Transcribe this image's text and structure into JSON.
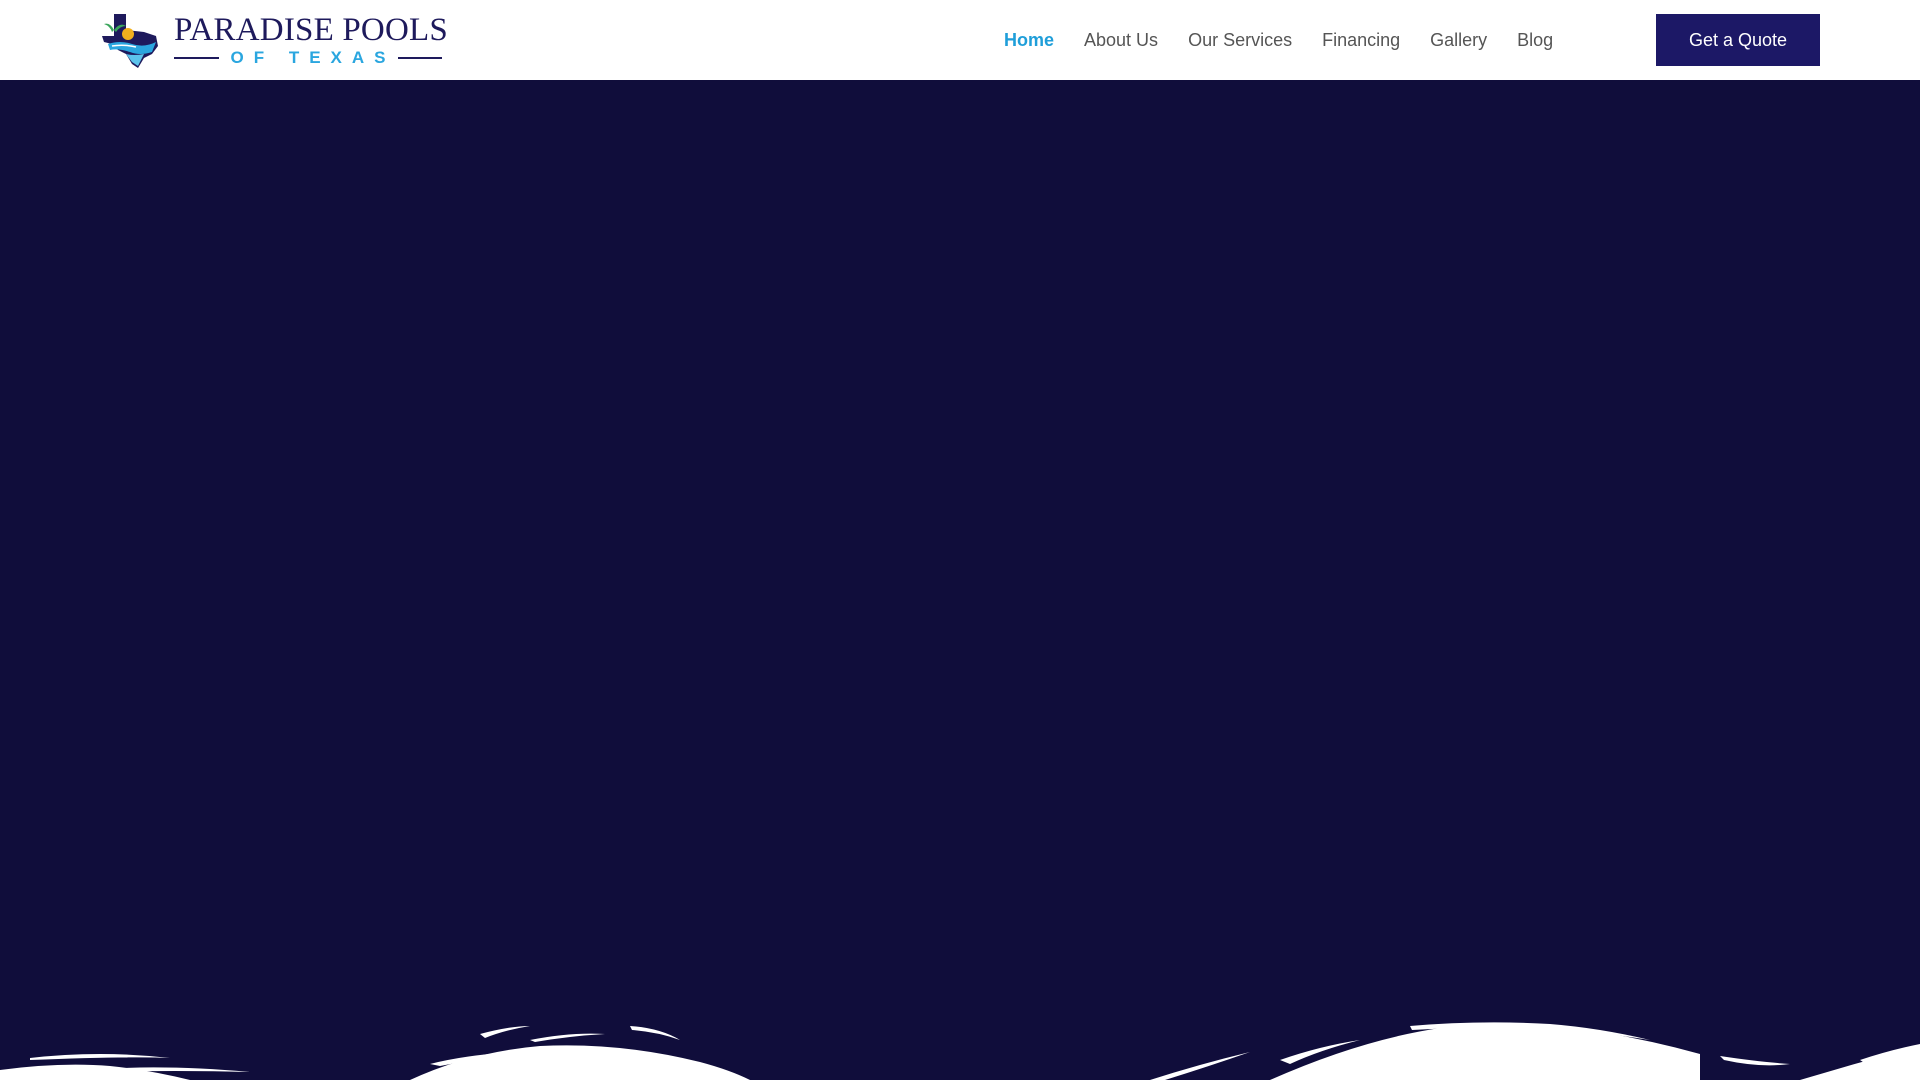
{
  "brand": {
    "name_primary": "PARADISE POOLS",
    "name_secondary": "OF TEXAS",
    "colors": {
      "navy": "#1e1a5c",
      "accent_blue": "#2aa6df",
      "sun_yellow": "#f2b01e",
      "palm_green": "#3aa55b"
    },
    "emblem_icon": "texas-pool-emblem-icon"
  },
  "nav": {
    "items": [
      {
        "label": "Home",
        "active": true
      },
      {
        "label": "About Us",
        "active": false
      },
      {
        "label": "Our Services",
        "active": false
      },
      {
        "label": "Financing",
        "active": false
      },
      {
        "label": "Gallery",
        "active": false
      },
      {
        "label": "Blog",
        "active": false
      }
    ],
    "active_color": "#1f9ed9",
    "text_color": "#555555"
  },
  "cta": {
    "quote_label": "Get a Quote",
    "background": "#1c1866"
  },
  "hero": {
    "background": "#100d3b",
    "wave_color": "#ffffff"
  }
}
